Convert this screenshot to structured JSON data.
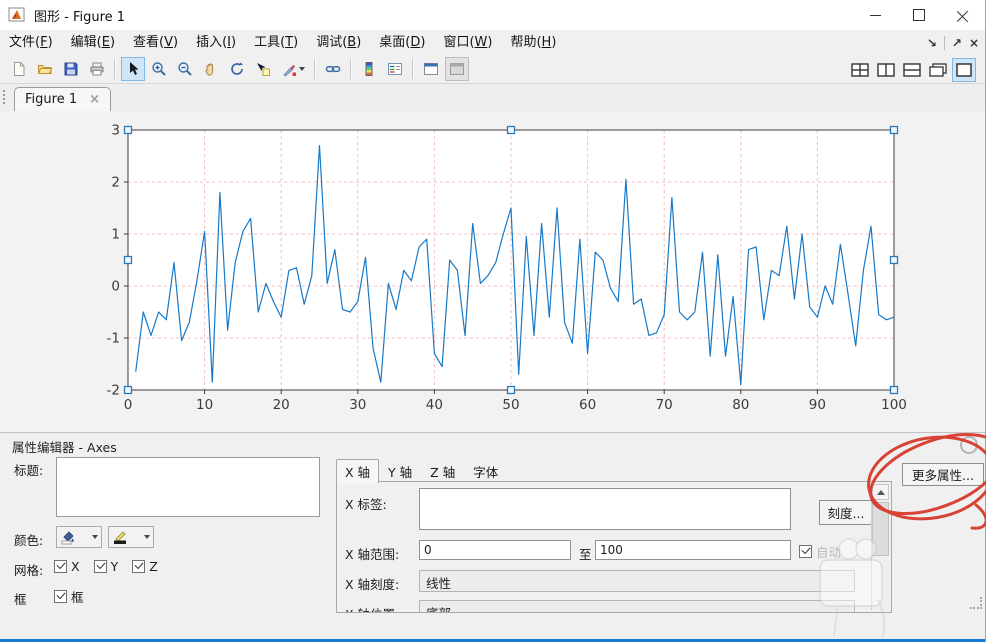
{
  "window": {
    "title": "图形 - Figure 1",
    "controls_icons": [
      "minimize-icon",
      "maximize-icon",
      "close-icon"
    ],
    "border_color": "#1679d2"
  },
  "menu": {
    "items": [
      {
        "name": "file",
        "label": "文件",
        "mnemonic": "F"
      },
      {
        "name": "edit",
        "label": "编辑",
        "mnemonic": "E"
      },
      {
        "name": "view",
        "label": "查看",
        "mnemonic": "V"
      },
      {
        "name": "insert",
        "label": "插入",
        "mnemonic": "I"
      },
      {
        "name": "tools",
        "label": "工具",
        "mnemonic": "T"
      },
      {
        "name": "debug",
        "label": "调试",
        "mnemonic": "B"
      },
      {
        "name": "desktop",
        "label": "桌面",
        "mnemonic": "D"
      },
      {
        "name": "window",
        "label": "窗口",
        "mnemonic": "W"
      },
      {
        "name": "help",
        "label": "帮助",
        "mnemonic": "H"
      }
    ],
    "right_icons": [
      {
        "name": "dock-figure-icon",
        "glyph": "↘"
      },
      {
        "name": "undock-figure-icon",
        "glyph": "↗"
      },
      {
        "name": "close-figure-icon",
        "glyph": "×"
      }
    ]
  },
  "toolbar": {
    "icons": [
      "new-figure-icon",
      "open-file-icon",
      "save-figure-icon",
      "print-figure-icon",
      "pointer-tool-icon",
      "zoom-in-icon",
      "zoom-out-icon",
      "pan-hand-icon",
      "rotate-3d-icon",
      "data-cursor-icon",
      "brush-data-icon",
      "link-plot-icon",
      "insert-colorbar-icon",
      "insert-legend-icon",
      "show-plot-tools-icon",
      "hide-plot-tools-icon"
    ],
    "layout_icons": [
      "layout-grid-icon",
      "layout-columns-icon",
      "layout-rows-icon",
      "layout-cascade-icon",
      "layout-single-icon"
    ],
    "selected_tool": "pointer-tool",
    "selected_layout": "layout-single",
    "selection_color": "#cfe6f8"
  },
  "tab": {
    "label": "Figure 1",
    "close_glyph": "×"
  },
  "chart_data": {
    "type": "line",
    "title": "",
    "xlabel": "",
    "ylabel": "",
    "x_range": [
      0,
      100
    ],
    "y_range": [
      -2,
      3
    ],
    "xticks": [
      0,
      10,
      20,
      30,
      40,
      50,
      60,
      70,
      80,
      90,
      100
    ],
    "yticks": [
      -2,
      -1,
      0,
      1,
      2,
      3
    ],
    "grid": true,
    "legend": "none",
    "x_start": 1,
    "x_step": 1,
    "values": [
      -1.65,
      -0.5,
      -0.95,
      -0.5,
      -0.65,
      0.45,
      -1.05,
      -0.7,
      0.1,
      1.05,
      -1.85,
      1.8,
      -0.85,
      0.45,
      1.05,
      1.3,
      -0.5,
      0.05,
      -0.3,
      -0.6,
      0.3,
      0.35,
      -0.35,
      0.2,
      2.7,
      0.05,
      0.7,
      -0.45,
      -0.5,
      -0.3,
      0.55,
      -1.2,
      -1.85,
      0.05,
      -0.45,
      0.3,
      0.1,
      0.75,
      0.9,
      -1.3,
      -1.55,
      0.5,
      0.3,
      -0.95,
      1.2,
      0.05,
      0.2,
      0.45,
      1.0,
      1.5,
      -1.7,
      0.95,
      -0.95,
      1.2,
      -0.6,
      1.5,
      -0.7,
      -1.1,
      0.9,
      -1.3,
      0.65,
      0.5,
      -0.05,
      -0.3,
      2.05,
      -0.35,
      -0.25,
      -0.95,
      -0.9,
      -0.55,
      1.7,
      -0.5,
      -0.65,
      -0.5,
      0.65,
      -1.35,
      0.6,
      -1.35,
      -0.2,
      -1.9,
      0.7,
      0.75,
      -0.65,
      0.3,
      0.2,
      1.15,
      -0.25,
      1.0,
      -0.4,
      -0.6,
      0.0,
      -0.35,
      0.8,
      -0.15,
      -1.15,
      0.3,
      1.15,
      -0.55,
      -0.65,
      -0.6
    ],
    "line_color": "#1779c8",
    "grid_color": "#f2bcbc",
    "axes_color": "#3c3c3c",
    "background": "#ffffff",
    "selected": true,
    "selection_handle_color": "#2c7bb8"
  },
  "property_editor": {
    "header": "属性编辑器 - Axes",
    "title_label": "标题:",
    "title_value": "",
    "color_label": "颜色:",
    "color_buttons": [
      "fill-color-picker",
      "line-color-picker"
    ],
    "grid_label": "网格:",
    "grid_checkboxes": [
      {
        "label": "X",
        "checked": true
      },
      {
        "label": "Y",
        "checked": true
      },
      {
        "label": "Z",
        "checked": true
      }
    ],
    "box_label": "框",
    "box_checkbox": {
      "label": "框",
      "checked": true
    },
    "tabs": [
      {
        "name": "x-axis",
        "label": "X 轴",
        "active": true
      },
      {
        "name": "y-axis",
        "label": "Y 轴",
        "active": false
      },
      {
        "name": "z-axis",
        "label": "Z 轴",
        "active": false
      },
      {
        "name": "font",
        "label": "字体",
        "active": false
      }
    ],
    "x_label_label": "X 标签:",
    "x_label_value": "",
    "ticks_button": "刻度...",
    "x_range_label": "X 轴范围:",
    "x_range_from": "0",
    "range_to_label": "至",
    "x_range_to": "100",
    "auto_checkbox": {
      "label": "自动",
      "checked": true
    },
    "x_scale_label": "X 轴刻度:",
    "x_scale_value": "线性",
    "x_position_label": "X 轴位置:",
    "x_position_value": "底部",
    "more_properties_button": "更多属性..."
  },
  "annotation": {
    "type": "hand-drawn-red-circle",
    "target": "more-properties-button",
    "color": "#d73527"
  }
}
